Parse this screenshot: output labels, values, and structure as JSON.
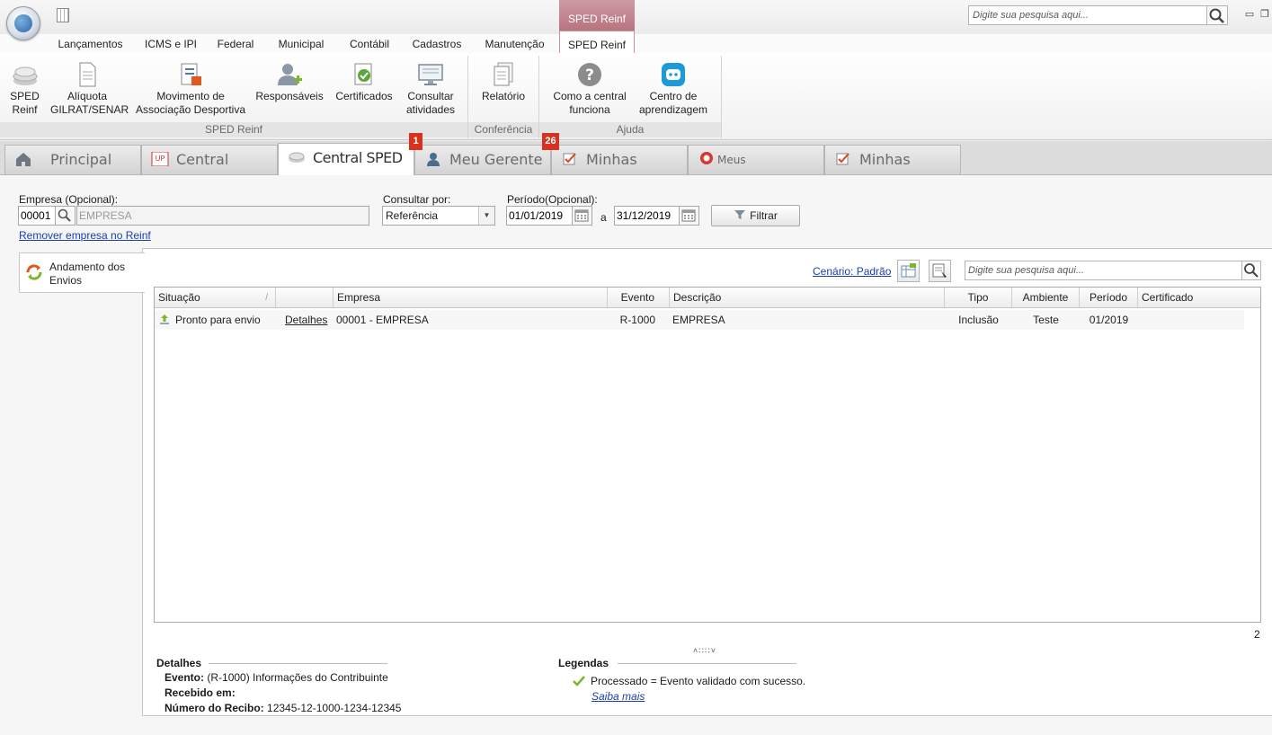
{
  "titlebar": {
    "context_tab": "SPED Reinf",
    "search_placeholder": "Digite sua pesquisa aqui..."
  },
  "menu": {
    "items": [
      "Lançamentos",
      "ICMS e IPI",
      "Federal",
      "Municipal",
      "Contábil",
      "Cadastros",
      "Manutenção",
      "SPED Reinf"
    ]
  },
  "ribbon": {
    "buttons": [
      {
        "label1": "SPED",
        "label2": "Reinf"
      },
      {
        "label1": "Alíquota",
        "label2": "GILRAT/SENAR"
      },
      {
        "label1": "Movimento de",
        "label2": "Associação Desportiva"
      },
      {
        "label1": "Responsáveis",
        "label2": ""
      },
      {
        "label1": "Certificados",
        "label2": ""
      },
      {
        "label1": "Consultar",
        "label2": "atividades"
      },
      {
        "label1": "Relatório",
        "label2": ""
      },
      {
        "label1": "Como a central",
        "label2": "funciona"
      },
      {
        "label1": "Centro de",
        "label2": "aprendizagem"
      }
    ],
    "groups": [
      "SPED Reinf",
      "Conferência",
      "Ajuda"
    ]
  },
  "doc_tabs": [
    {
      "label": "Principal"
    },
    {
      "label": "Central PackUp"
    },
    {
      "label": "Central SPED Reinf",
      "badge": "1"
    },
    {
      "label": "Meu Gerente",
      "badge": "26"
    },
    {
      "label": "Minhas tarefas"
    },
    {
      "label": "Meus Atendimentos"
    },
    {
      "label": "Minhas tarefas"
    }
  ],
  "icons": {
    "logo": "globe-logo-icon",
    "calculator": "calculator-icon",
    "search": "search-icon",
    "minimize": "minimize-icon",
    "restore": "restore-icon",
    "home": "home-icon",
    "calendar": "calendar-icon",
    "filter": "filter-icon",
    "upload": "upload-arrow-icon",
    "check": "check-icon",
    "refresh": "refresh-arrows-icon"
  },
  "filters": {
    "empresa_label": "Empresa (Opcional):",
    "empresa_code": "00001",
    "empresa_name": "EMPRESA",
    "remove_link": "Remover empresa no Reinf",
    "consultar_label": "Consultar por:",
    "consultar_value": "Referência",
    "periodo_label": "Período(Opcional):",
    "date_from": "01/01/2019",
    "date_sep": "a",
    "date_to": "31/12/2019",
    "filter_button": "Filtrar"
  },
  "side": {
    "tab_label1": "Andamento dos",
    "tab_label2": "Envios"
  },
  "toolbar": {
    "scenario_link": "Cenário: Padrão",
    "search_placeholder": "Digite sua pesquisa aqui..."
  },
  "grid": {
    "headers": [
      "Situação",
      "",
      "Empresa",
      "Evento",
      "Descrição",
      "Tipo",
      "Ambiente",
      "Período",
      "Certificado"
    ],
    "rows": [
      {
        "situacao": "Pronto para envio",
        "detalhes": "Detalhes",
        "empresa": "00001 - EMPRESA",
        "evento": "R-1000",
        "descricao": "EMPRESA",
        "tipo": "Inclusão",
        "ambiente": "Teste",
        "periodo": "01/2019",
        "certificado": ""
      }
    ],
    "count": "2"
  },
  "details": {
    "title": "Detalhes",
    "evento_label": "Evento:",
    "evento_value": "(R-1000) Informações do Contribuinte",
    "recebido_label": "Recebido em:",
    "recebido_value": "",
    "recibo_label": "Número do Recibo:",
    "recibo_value": "12345-12-1000-1234-12345"
  },
  "legend": {
    "title": "Legendas",
    "processed_text": "Processado = Evento validado com sucesso.",
    "more_link": "Saiba mais"
  },
  "colors": {
    "accent_context": "#b9737f",
    "badge": "#d6321f",
    "link": "#1a3fa8"
  }
}
